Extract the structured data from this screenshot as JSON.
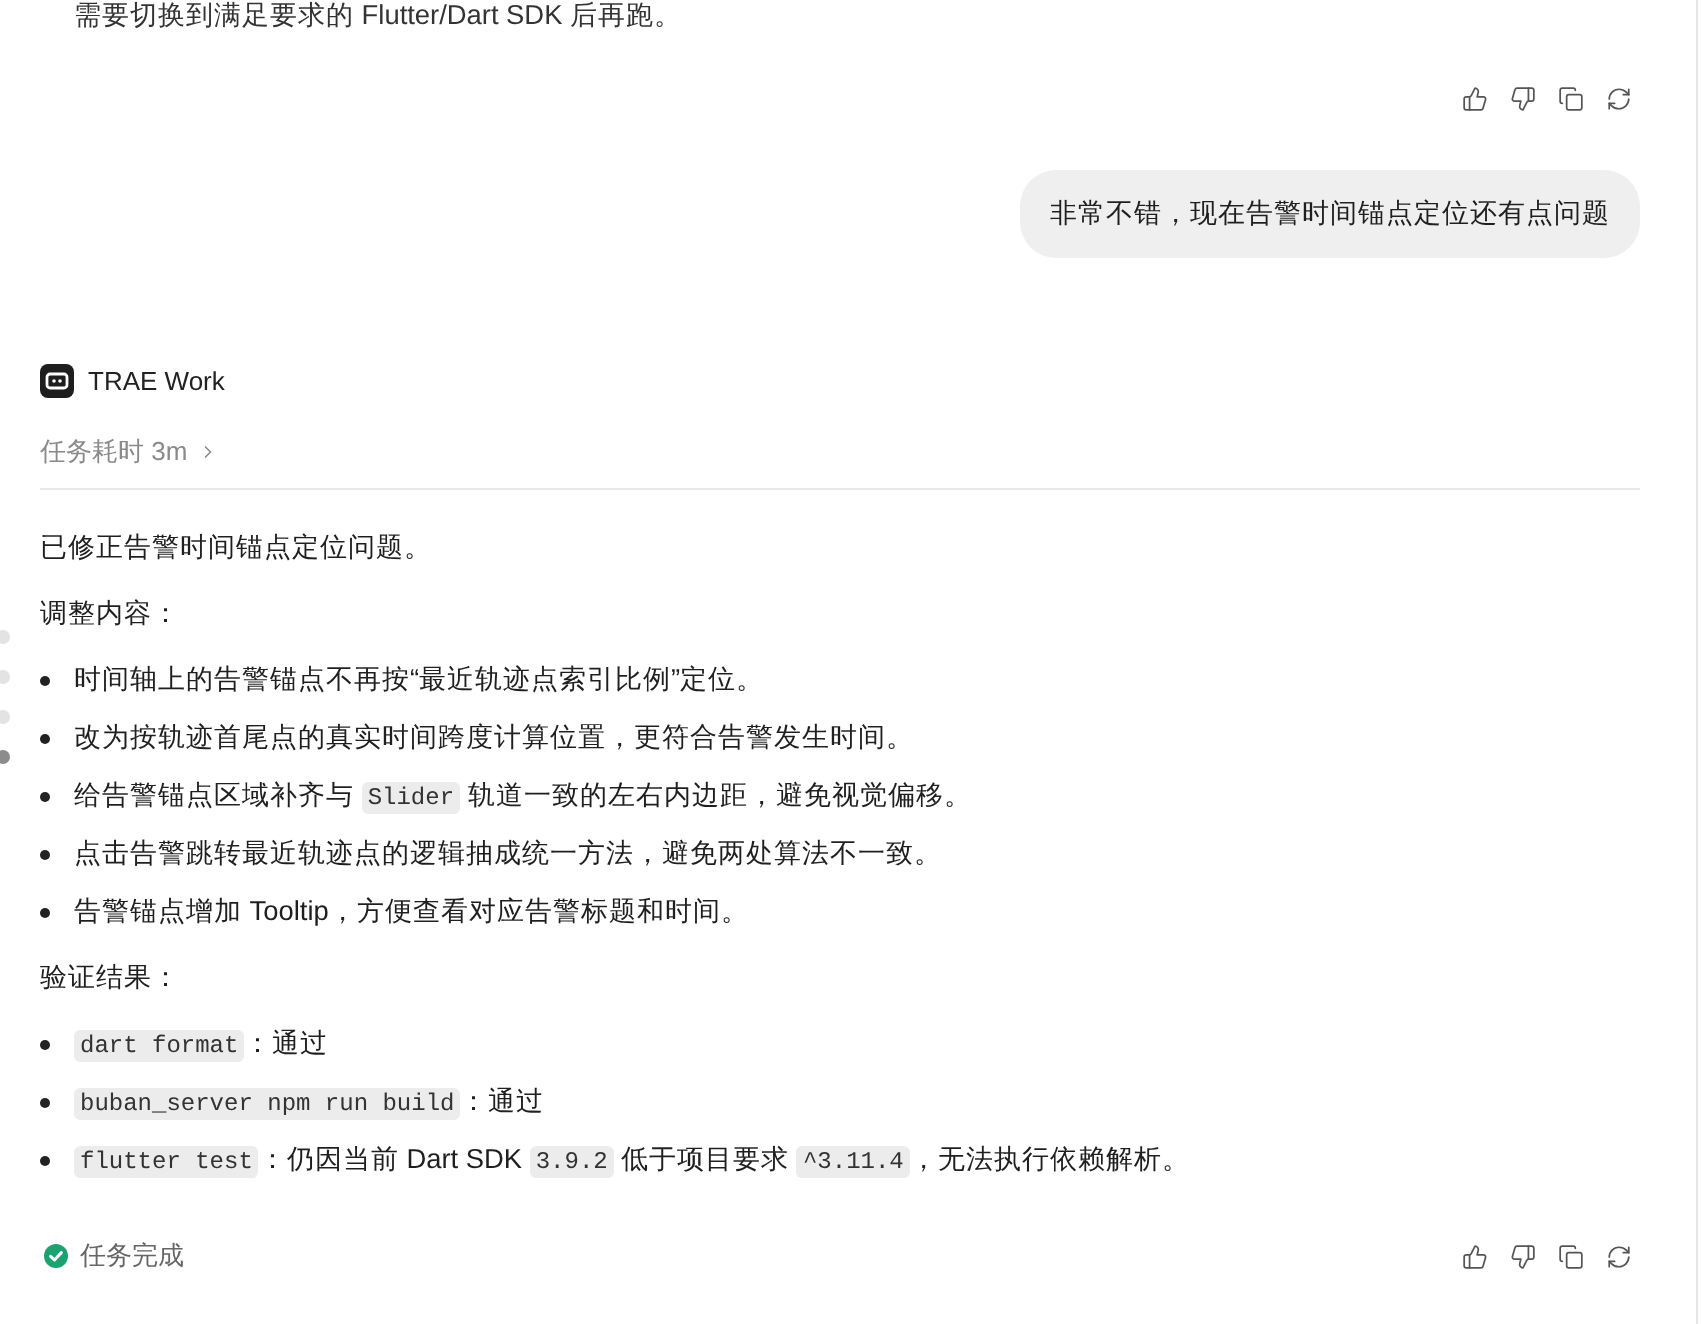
{
  "previous_message": {
    "text": "需要切换到满足要求的 Flutter/Dart SDK 后再跑。"
  },
  "user_message": {
    "text": "非常不错，现在告警时间锚点定位还有点问题"
  },
  "assistant": {
    "name": "TRAE Work",
    "duration": "任务耗时 3m",
    "blocks": [
      {
        "kind": "paragraph",
        "segments": [
          {
            "text": "已修正告警时间锚点定位问题。",
            "code": false
          }
        ]
      },
      {
        "kind": "paragraph",
        "segments": [
          {
            "text": "调整内容：",
            "code": false
          }
        ]
      },
      {
        "kind": "list",
        "items": [
          {
            "segments": [
              {
                "text": "时间轴上的告警锚点不再按“最近轨迹点索引比例”定位。",
                "code": false
              }
            ]
          },
          {
            "segments": [
              {
                "text": "改为按轨迹首尾点的真实时间跨度计算位置，更符合告警发生时间。",
                "code": false
              }
            ]
          },
          {
            "segments": [
              {
                "text": "给告警锚点区域补齐与 ",
                "code": false
              },
              {
                "text": "Slider",
                "code": true
              },
              {
                "text": " 轨道一致的左右内边距，避免视觉偏移。",
                "code": false
              }
            ]
          },
          {
            "segments": [
              {
                "text": "点击告警跳转最近轨迹点的逻辑抽成统一方法，避免两处算法不一致。",
                "code": false
              }
            ]
          },
          {
            "segments": [
              {
                "text": "告警锚点增加 Tooltip，方便查看对应告警标题和时间。",
                "code": false
              }
            ]
          }
        ]
      },
      {
        "kind": "paragraph",
        "segments": [
          {
            "text": "验证结果：",
            "code": false
          }
        ]
      },
      {
        "kind": "list",
        "items": [
          {
            "segments": [
              {
                "text": "dart format",
                "code": true
              },
              {
                "text": "：通过",
                "code": false
              }
            ]
          },
          {
            "segments": [
              {
                "text": "buban_server npm run build",
                "code": true
              },
              {
                "text": "：通过",
                "code": false
              }
            ]
          },
          {
            "segments": [
              {
                "text": "flutter test",
                "code": true
              },
              {
                "text": "：仍因当前 Dart SDK ",
                "code": false
              },
              {
                "text": "3.9.2",
                "code": true
              },
              {
                "text": " 低于项目要求 ",
                "code": false
              },
              {
                "text": "^3.11.4",
                "code": true
              },
              {
                "text": "，无法执行依赖解析。",
                "code": false
              }
            ]
          }
        ]
      }
    ]
  },
  "status": {
    "label": "任务完成",
    "completed": true
  },
  "nav_dots": [
    {
      "selected": false
    },
    {
      "selected": false
    },
    {
      "selected": false
    },
    {
      "selected": true
    }
  ]
}
